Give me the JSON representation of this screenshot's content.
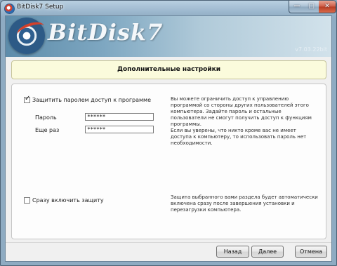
{
  "window": {
    "title": "BitDisk7 Setup",
    "controls": {
      "minimize": "—",
      "maximize": "□",
      "close": "✕"
    }
  },
  "banner": {
    "logo_text": "BitDisk7",
    "version": "v7.03.22bit"
  },
  "header": {
    "title": "Дополнительные настройки"
  },
  "password_section": {
    "checkbox_label": "Защитить паролем доступ к программе",
    "checkbox_checked": true,
    "password_label": "Пароль",
    "password_value": "******",
    "confirm_label": "Еще раз",
    "confirm_value": "******",
    "description": [
      "Вы можете ограничить доступ к управлению",
      "программой со стороны других пользователей этого",
      "компьютера. Задайте пароль и остальные",
      "пользователи не смогут получить доступ к функциям",
      "программы.",
      "Если вы уверены, что никто кроме вас не имеет",
      "доступа к компьютеру, то использовать пароль нет",
      "необходимости."
    ]
  },
  "protection_section": {
    "checkbox_label": "Сразу включить защиту",
    "checkbox_checked": false,
    "description": [
      "Защита выбранного вами раздела будет автоматически",
      "включена сразу после завершения установки и",
      "перезагрузки компьютера."
    ]
  },
  "buttons": {
    "back": "Назад",
    "next": "Далее",
    "cancel": "Отмена"
  },
  "colors": {
    "header_background": "#fbfbdc",
    "banner_start": "#5d8caa",
    "banner_end": "#d2e2eb",
    "close_button": "#c8503a"
  }
}
